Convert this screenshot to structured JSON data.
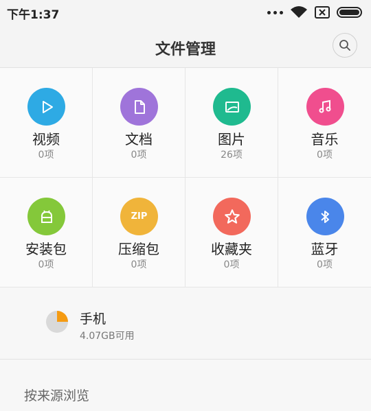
{
  "status": {
    "time": "下午1:37"
  },
  "header": {
    "title": "文件管理"
  },
  "categories": [
    {
      "label": "视频",
      "count": "0项",
      "color": "#2eaae4",
      "icon": "play-icon"
    },
    {
      "label": "文档",
      "count": "0项",
      "color": "#9f74da",
      "icon": "document-icon"
    },
    {
      "label": "图片",
      "count": "26项",
      "color": "#1fba8f",
      "icon": "image-icon"
    },
    {
      "label": "音乐",
      "count": "0项",
      "color": "#f04e8e",
      "icon": "music-icon"
    },
    {
      "label": "安装包",
      "count": "0项",
      "color": "#84c83a",
      "icon": "android-icon"
    },
    {
      "label": "压缩包",
      "count": "0项",
      "color": "#f0b43a",
      "icon": "zip-icon",
      "icon_text": "ZIP"
    },
    {
      "label": "收藏夹",
      "count": "0项",
      "color": "#f2695c",
      "icon": "star-icon"
    },
    {
      "label": "蓝牙",
      "count": "0项",
      "color": "#4a86ea",
      "icon": "bluetooth-icon"
    }
  ],
  "storage": {
    "name": "手机",
    "free": "4.07GB可用",
    "used_fraction": 0.25
  },
  "browse": {
    "label": "按来源浏览"
  }
}
